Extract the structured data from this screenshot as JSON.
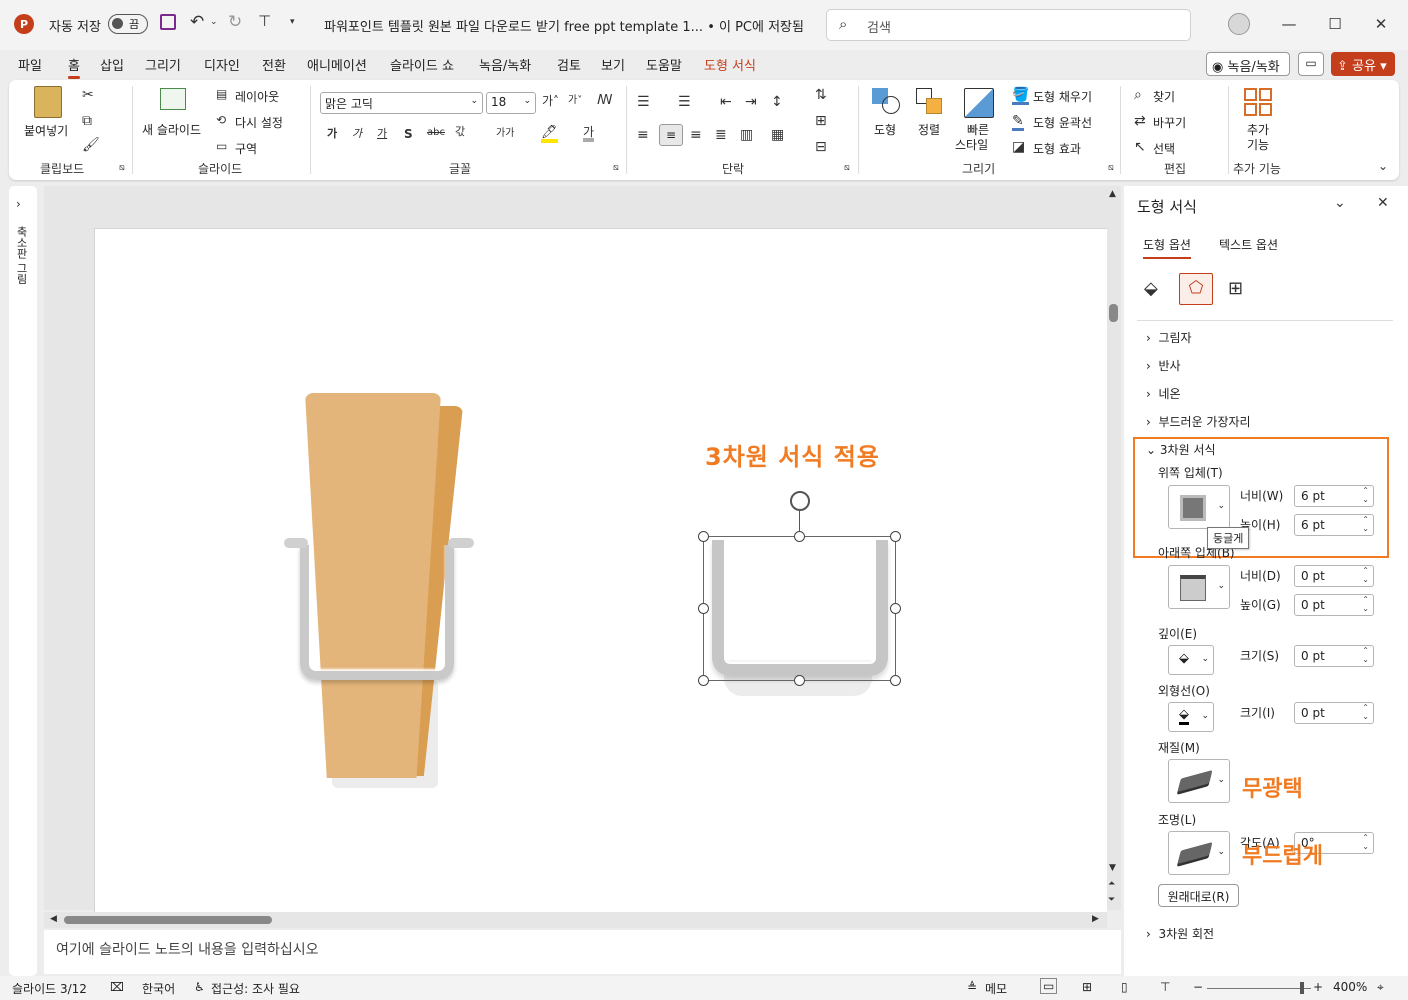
{
  "titlebar": {
    "autosave_label": "자동 저장",
    "autosave_state": "끔",
    "doc_title": "파워포인트 템플릿 원본 파일 다운로드 받기 free ppt template 1... • 이 PC에 저장됨",
    "search_placeholder": "검색"
  },
  "tabs": [
    "파일",
    "홈",
    "삽입",
    "그리기",
    "디자인",
    "전환",
    "애니메이션",
    "슬라이드 쇼",
    "녹음/녹화",
    "검토",
    "보기",
    "도움말",
    "도형 서식"
  ],
  "tab_actions": {
    "record": "녹음/녹화",
    "share": "공유"
  },
  "ribbon": {
    "clipboard": {
      "paste": "붙여넣기",
      "group": "클립보드"
    },
    "slides": {
      "new_slide": "새 슬라이드",
      "layout": "레이아웃",
      "reset": "다시 설정",
      "section": "구역",
      "group": "슬라이드"
    },
    "font": {
      "font_name": "맑은 고딕",
      "font_size": "18",
      "group": "글꼴"
    },
    "paragraph": {
      "group": "단락"
    },
    "drawing": {
      "shapes": "도형",
      "arrange": "정렬",
      "quick_styles_1": "빠른",
      "quick_styles_2": "스타일",
      "fill": "도형 채우기",
      "outline": "도형 윤곽선",
      "effects": "도형 효과",
      "group": "그리기"
    },
    "editing": {
      "find": "찾기",
      "replace": "바꾸기",
      "select": "선택",
      "group": "편집"
    },
    "addins": {
      "label_1": "추가",
      "label_2": "기능",
      "group": "추가 기능"
    }
  },
  "left_strip": {
    "label": "축소판 그림"
  },
  "slide": {
    "annotation": "3차원 서식 적용"
  },
  "notes": {
    "placeholder": "여기에 슬라이드 노트의 내용을 입력하십시오"
  },
  "pane": {
    "title": "도형 서식",
    "tabs": [
      "도형 옵션",
      "텍스트 옵션"
    ],
    "sections": [
      "그림자",
      "반사",
      "네온",
      "부드러운 가장자리"
    ],
    "format3d": {
      "header": "3차원 서식",
      "top_bevel": "위쪽 입체(T)",
      "bottom_bevel": "아래쪽 입체(B)",
      "width_w": "너비(W)",
      "height_h": "높이(H)",
      "width_d": "너비(D)",
      "height_g": "높이(G)",
      "top_width": "6 pt",
      "top_height": "6 pt",
      "bottom_width": "0 pt",
      "bottom_height": "0 pt",
      "tooltip": "둥글게",
      "depth": "깊이(E)",
      "depth_size_label": "크기(S)",
      "depth_size": "0 pt",
      "contour": "외형선(O)",
      "contour_size_label": "크기(I)",
      "contour_size": "0 pt",
      "material": "재질(M)",
      "material_note": "무광택",
      "lighting": "조명(L)",
      "lighting_note": "부드럽게",
      "angle_label": "각도(A)",
      "angle": "0°",
      "reset": "원래대로(R)"
    },
    "rotation3d": "3차원 회전"
  },
  "status": {
    "slide_info": "슬라이드 3/12",
    "language": "한국어",
    "accessibility": "접근성: 조사 필요",
    "notes": "메모",
    "zoom": "400%"
  },
  "colors": {
    "accent": "#c43e1c",
    "annotation": "#f07b22",
    "clothespin": "#e3b57a"
  }
}
